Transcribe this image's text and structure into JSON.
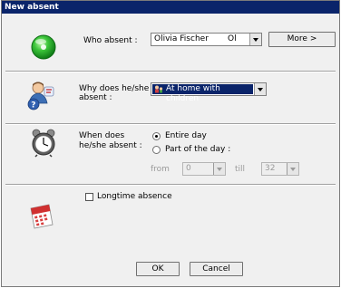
{
  "window": {
    "title": "New absent"
  },
  "who": {
    "label": "Who absent :",
    "person": "Olivia Fischer",
    "code": "Ol",
    "more_label": "More >"
  },
  "why": {
    "label_line1": "Why does he/she",
    "label_line2": "absent :",
    "reason": "At home with children"
  },
  "when": {
    "label_line1": "When does",
    "label_line2": "he/she absent :",
    "entire_day_label": "Entire day",
    "part_day_label": "Part of the day :",
    "from_label": "from",
    "from_value": "0",
    "till_label": "till",
    "till_value": "32",
    "selected": "entire-day"
  },
  "longtime": {
    "label": "Longtime absence",
    "checked": false
  },
  "buttons": {
    "ok_label": "OK",
    "cancel_label": "Cancel"
  },
  "icons": {
    "who": "green-status-icon",
    "why": "person-question-icon",
    "when": "alarm-clock-icon",
    "longtime": "calendar-icon"
  },
  "colors": {
    "titlebar": "#0a246a",
    "reason_highlight": "#0a246a",
    "status_green": "#22b42a"
  }
}
